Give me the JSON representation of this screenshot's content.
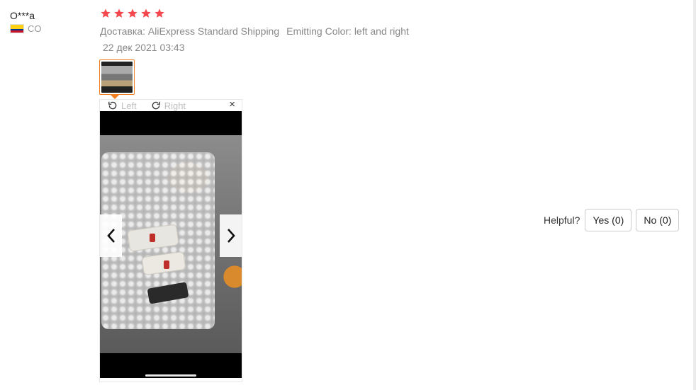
{
  "reviewer": {
    "name": "O***a",
    "country": "CO"
  },
  "rating": {
    "stars": 5,
    "max": 5,
    "color": "#f5474e"
  },
  "review": {
    "delivery": "Доставка: AliExpress Standard Shipping",
    "emitting_color": "Emitting Color: left and right",
    "date": "22 дек 2021 03:43"
  },
  "viewer": {
    "rotate_left_label": "Left",
    "rotate_right_label": "Right",
    "close_label": "×"
  },
  "helpful": {
    "label": "Helpful?",
    "yes_label": "Yes (0)",
    "no_label": "No (0)"
  },
  "colors": {
    "accent": "#f07e23",
    "meta_text": "#888888"
  }
}
